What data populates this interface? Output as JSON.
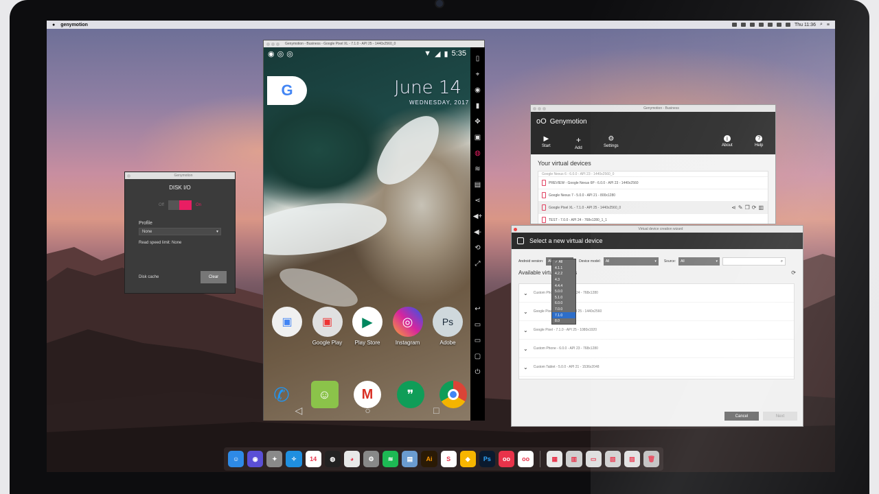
{
  "menubar": {
    "app_name": "genymotion",
    "clock": "Thu 11:36"
  },
  "phone": {
    "window_title": "Genymotion - Business - Google Pixel XL - 7.1.0 - API 25 - 1440x2560_0",
    "status_time": "5:35",
    "google_letter": "G",
    "date_big": "June 14",
    "date_small": "WEDNESDAY, 2017",
    "apps": [
      {
        "label": "",
        "icon": "google-folder"
      },
      {
        "label": "Google Play",
        "icon": "play-folder"
      },
      {
        "label": "Play Store",
        "icon": "play-store"
      },
      {
        "label": "Instagram",
        "icon": "instagram"
      },
      {
        "label": "Adobe",
        "icon": "adobe-folder"
      }
    ],
    "dock_apps": [
      "phone",
      "messenger",
      "gmail",
      "hangouts",
      "chrome"
    ],
    "nav": {
      "back": "◁",
      "home": "○",
      "recent": "□"
    },
    "toolbar_icons": [
      "battery-icon",
      "gps-icon",
      "webcam-icon",
      "phone-icon",
      "move-icon",
      "id-icon",
      "disk-icon",
      "wifi-icon",
      "sms-icon",
      "share-icon",
      "volume-up-icon",
      "volume-down-icon",
      "rotate-icon",
      "fullscreen-icon",
      "back-icon",
      "menu-icon",
      "home-icon",
      "recent-icon",
      "power-icon"
    ]
  },
  "diskio": {
    "window_title": "Genymotion",
    "header": "DISK I/O",
    "toggle_off": "Off",
    "toggle_on": "On",
    "profile_label": "Profile",
    "profile_value": "None",
    "read_speed": "Read speed limit: None",
    "disk_cache": "Disk cache",
    "clear_button": "Clear"
  },
  "genymotion": {
    "window_title": "Genymotion - Business",
    "brand": "Genymotion",
    "toolbar": [
      {
        "label": "Start",
        "icon": "▶"
      },
      {
        "label": "Add",
        "icon": "+"
      },
      {
        "label": "Settings",
        "icon": "⚙"
      },
      {
        "label": "About",
        "icon": "i"
      },
      {
        "label": "Help",
        "icon": "?"
      }
    ],
    "devices_heading": "Your virtual devices",
    "devices": [
      {
        "name": "Google Nexus 6 - 6.0.0 - API 23 - 1440x2560_0"
      },
      {
        "name": "PREVIEW - Google Nexus 6P - 6.0.0 - API 23 - 1440x2560"
      },
      {
        "name": "Google Nexus 7 - 5.0.0 - API 21 - 800x1280"
      },
      {
        "name": "Google Pixel XL - 7.1.0 - API 25 - 1440x2560_0"
      },
      {
        "name": "TEST - 7.0.0 - API 24 - 768x1280_1_1"
      }
    ]
  },
  "wizard": {
    "window_title": "Virtual device creation wizard",
    "heading": "Select a new virtual device",
    "android_version_label": "Android version:",
    "android_version_value": "All",
    "device_model_label": "Device model:",
    "device_model_value": "All",
    "source_label": "Source:",
    "source_value": "All",
    "available_heading": "Available virtual devices",
    "version_options": [
      "All",
      "4.1.1",
      "4.2.2",
      "4.3",
      "4.4.4",
      "5.0.0",
      "5.1.0",
      "6.0.0",
      "7.0.0",
      "7.1.0",
      "8.0"
    ],
    "highlighted_option": "7.1.0",
    "items": [
      {
        "name": "Custom Phone - 7.1.0 - API 24 - 768x1280"
      },
      {
        "name": "Google Pixel XL - 7.1.0 - API 25 - 1440x2560"
      },
      {
        "name": "Google Pixel - 7.1.0 - API 25 - 1080x1920"
      },
      {
        "name": "Custom Phone - 6.0.0 - API 23 - 768x1280"
      },
      {
        "name": "Custom Tablet - 5.0.0 - API 21 - 1536x2048"
      }
    ],
    "cancel": "Cancel",
    "next": "Next"
  },
  "dock": {
    "items": [
      {
        "name": "finder",
        "color": "#2e8ae6",
        "glyph": "☺"
      },
      {
        "name": "siri",
        "color": "#5a4fd6",
        "glyph": "◉"
      },
      {
        "name": "launchpad",
        "color": "#8a8a8a",
        "glyph": "✦"
      },
      {
        "name": "safari",
        "color": "#1f8fe0",
        "glyph": "✧"
      },
      {
        "name": "calendar",
        "color": "#ffffff",
        "glyph": "14"
      },
      {
        "name": "activity-monitor",
        "color": "#222222",
        "glyph": "◍"
      },
      {
        "name": "chrome",
        "color": "#e8e8e8",
        "glyph": "◕"
      },
      {
        "name": "system-preferences",
        "color": "#888888",
        "glyph": "⚙"
      },
      {
        "name": "spotify",
        "color": "#1db954",
        "glyph": "≋"
      },
      {
        "name": "preview",
        "color": "#6a9bd0",
        "glyph": "▤"
      },
      {
        "name": "illustrator",
        "color": "#2a1a05",
        "glyph": "Ai"
      },
      {
        "name": "slack",
        "color": "#ffffff",
        "glyph": "S"
      },
      {
        "name": "sketch",
        "color": "#f7b500",
        "glyph": "◆"
      },
      {
        "name": "photoshop",
        "color": "#0a1a2e",
        "glyph": "Ps"
      },
      {
        "name": "genymotion",
        "color": "#e8334a",
        "glyph": "oo"
      },
      {
        "name": "genymotion-business",
        "color": "#ffffff",
        "glyph": "oo"
      },
      {
        "name": "doc-1",
        "color": "#e8e8e8",
        "glyph": "▦"
      },
      {
        "name": "doc-2",
        "color": "#cfcfcf",
        "glyph": "▥"
      },
      {
        "name": "doc-3",
        "color": "#dedede",
        "glyph": "▭"
      },
      {
        "name": "doc-4",
        "color": "#d0d0d0",
        "glyph": "▧"
      },
      {
        "name": "doc-5",
        "color": "#e0e0e0",
        "glyph": "▨"
      },
      {
        "name": "trash",
        "color": "#bfbfbf",
        "glyph": "🗑"
      }
    ]
  },
  "colors": {
    "accent": "#e91e63",
    "genymotion_red": "#e8334a",
    "dark_header": "#2b2b2b",
    "highlight_blue": "#2d6ec9"
  }
}
